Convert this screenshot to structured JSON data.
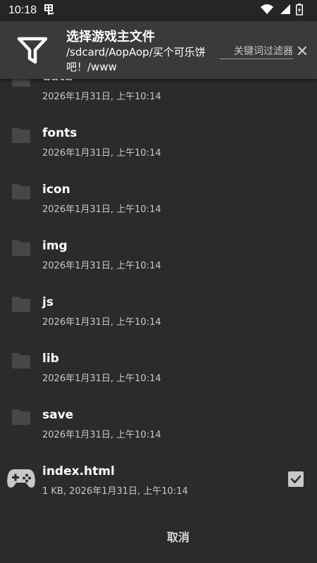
{
  "status_bar": {
    "time": "10:18",
    "left_icon": "notification-icon",
    "right_icons": [
      "wifi-icon",
      "signal-icon",
      "battery-icon"
    ]
  },
  "header": {
    "title": "选择游戏主文件",
    "path": "/sdcard/AopAop/买个可乐饼吧！/www",
    "filter_icon": "filter-icon",
    "keyword_placeholder": "关键词过滤器",
    "clear_icon": "close-icon"
  },
  "folders": [
    {
      "name": "data",
      "modified": "2026年1月31日, 上午10:14"
    },
    {
      "name": "fonts",
      "modified": "2026年1月31日, 上午10:14"
    },
    {
      "name": "icon",
      "modified": "2026年1月31日, 上午10:14"
    },
    {
      "name": "img",
      "modified": "2026年1月31日, 上午10:14"
    },
    {
      "name": "js",
      "modified": "2026年1月31日, 上午10:14"
    },
    {
      "name": "lib",
      "modified": "2026年1月31日, 上午10:14"
    },
    {
      "name": "save",
      "modified": "2026年1月31日, 上午10:14"
    }
  ],
  "file": {
    "name": "index.html",
    "meta": "1 KB, 2026年1月31日, 上午10:14",
    "icon": "gamepad-icon",
    "checked": true
  },
  "footer": {
    "cancel_label": "取消"
  },
  "colors": {
    "background": "#2b2b2b",
    "header_background": "#3a3a3a",
    "status_bar": "#252525",
    "folder_icon": "#474747",
    "secondary_text": "#c8c8c8"
  }
}
